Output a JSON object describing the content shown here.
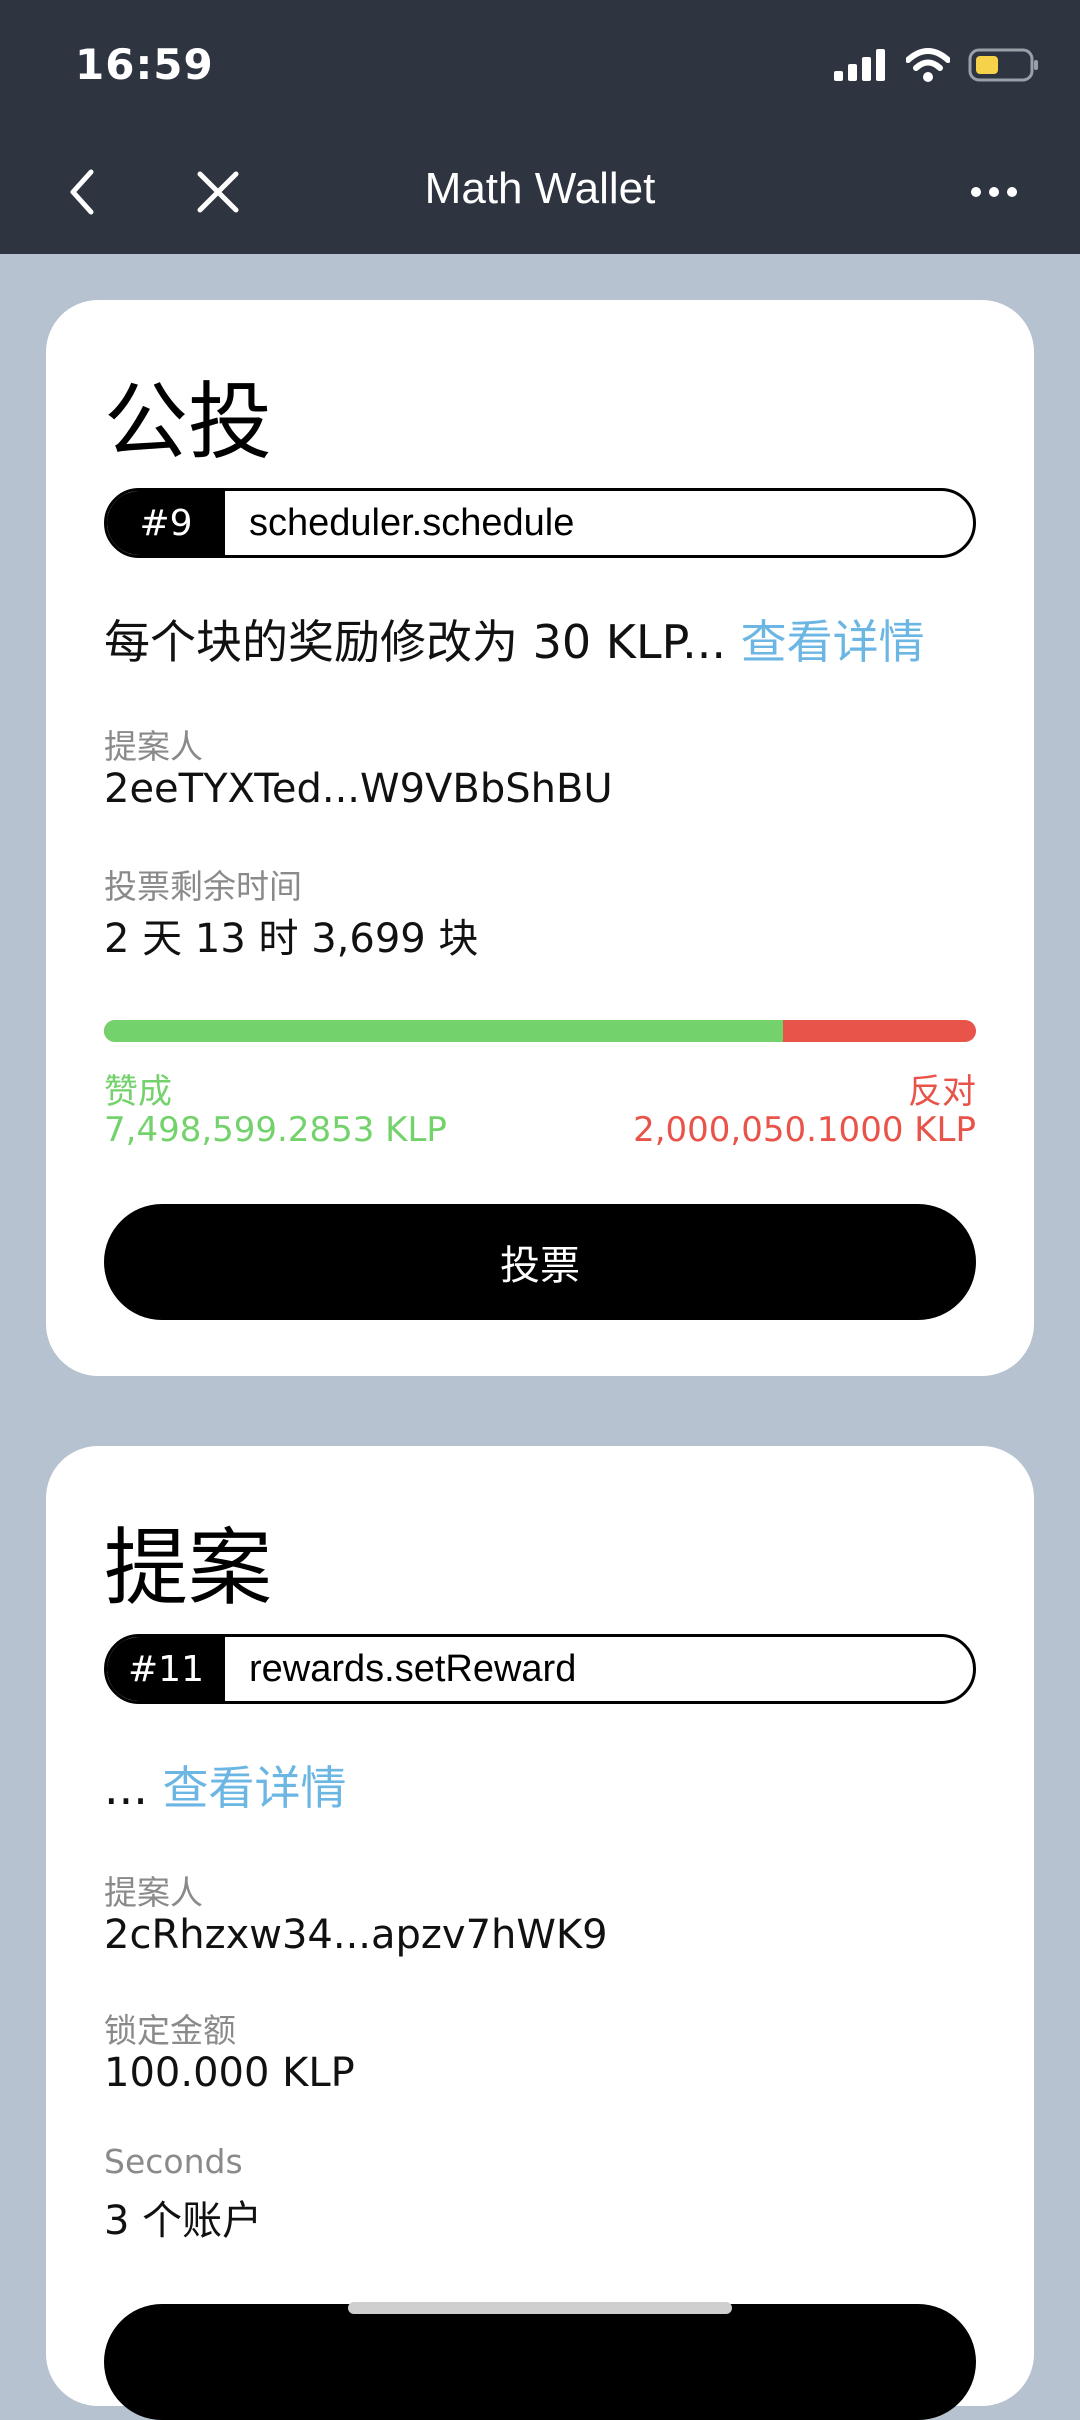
{
  "status": {
    "time": "16:59"
  },
  "nav": {
    "title": "Math Wallet"
  },
  "referendum": {
    "heading": "公投",
    "number": "#9",
    "method": "scheduler.schedule",
    "description": "每个块的奖励修改为 30 KLP...",
    "details_link": "查看详情",
    "proposer_label": "提案人",
    "proposer": "2eeTYXTed...W9VBbShBU",
    "remaining_label": "投票剩余时间",
    "remaining": "2 天 13 时 3,699 块",
    "aye_fraction": 0.779,
    "aye_label": "赞成",
    "aye_amount": "7,498,599.2853 KLP",
    "nay_label": "反对",
    "nay_amount": "2,000,050.1000 KLP",
    "vote_button": "投票"
  },
  "proposal": {
    "heading": "提案",
    "number": "#11",
    "method": "rewards.setReward",
    "description": "...",
    "details_link": "查看详情",
    "proposer_label": "提案人",
    "proposer": "2cRhzxw34...apzv7hWK9",
    "locked_label": "锁定金额",
    "locked": "100.000 KLP",
    "seconds_label": "Seconds",
    "seconds": "3 个账户"
  },
  "colors": {
    "accent_link": "#6bb6e3",
    "aye": "#74d26c",
    "nay": "#e8534a",
    "navbar": "#2f3540"
  }
}
